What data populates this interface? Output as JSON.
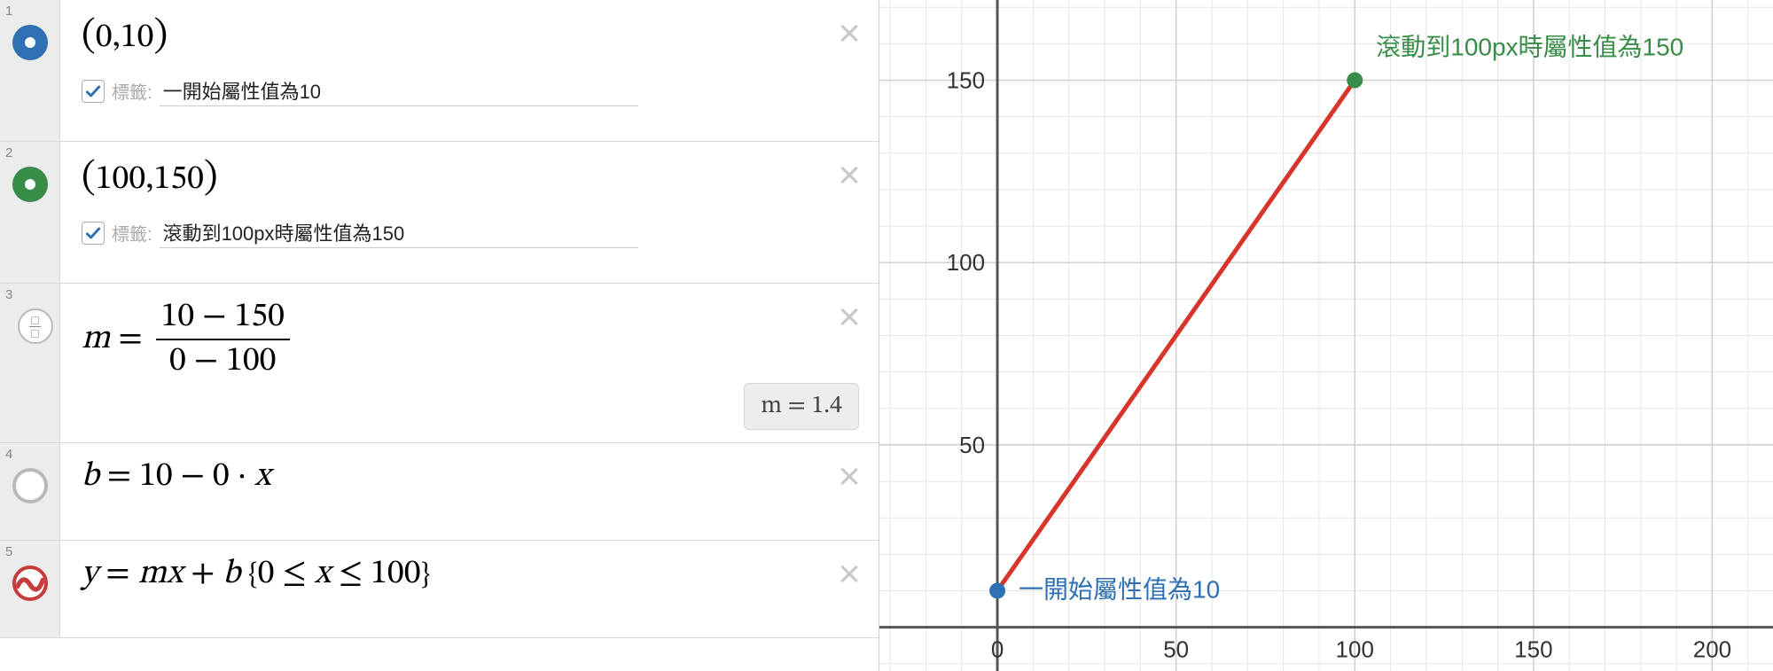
{
  "rows": [
    {
      "index": "1",
      "marker": "blue",
      "math_html": "<span class='paren'>(</span>0,10<span class='paren'>)</span>",
      "label_checked": true,
      "label_hint": "標籤:",
      "label_value": "一開始屬性值為10"
    },
    {
      "index": "2",
      "marker": "green",
      "math_html": "<span class='paren'>(</span>100,150<span class='paren'>)</span>",
      "label_checked": true,
      "label_hint": "標籤:",
      "label_value": "滾動到100px時屬性值為150"
    },
    {
      "index": "3",
      "marker": "frac",
      "math_html": "<span class='it'>m</span> = <span class='frac'><span class='num'>10 − 150</span><span class='den'>0 − 100</span></span>",
      "result": "m  =  1.4"
    },
    {
      "index": "4",
      "marker": "gray",
      "math_html": "<span class='it'>b</span> = 10 − 0 · <span class='it'>x</span>"
    },
    {
      "index": "5",
      "marker": "red",
      "math_html": "<span class='it'>y</span> = <span class='it'>m</span><span class='it'>x</span> + <span class='it'>b</span> <span class='small'>{</span>0 ≤ <span class='it'>x</span> ≤ 100<span class='small'>}</span>"
    }
  ],
  "graph": {
    "x_ticks": [
      0,
      50,
      100,
      150,
      200
    ],
    "y_ticks": [
      50,
      100,
      150
    ],
    "points": [
      {
        "x": 0,
        "y": 10,
        "color": "#2e70b3",
        "label": "一開始屬性值為10",
        "label_color": "#2e70b3",
        "label_dx": 24,
        "label_dy": 8
      },
      {
        "x": 100,
        "y": 150,
        "color": "#378c47",
        "label": "滾動到100px時屬性值為150",
        "label_color": "#378c47",
        "label_dx": 24,
        "label_dy": -28
      }
    ],
    "line_color": "#d9342b"
  },
  "chart_data": {
    "type": "line",
    "title": "",
    "xlabel": "",
    "ylabel": "",
    "xlim": [
      -10,
      215
    ],
    "ylim": [
      -10,
      170
    ],
    "x": [
      0,
      100
    ],
    "y": [
      10,
      150
    ],
    "series": [
      {
        "name": "y = mx + b (m=1.4, b=10)",
        "x": [
          0,
          100
        ],
        "y": [
          10,
          150
        ],
        "color": "#d9342b"
      }
    ],
    "annotations": [
      {
        "x": 0,
        "y": 10,
        "text": "一開始屬性值為10",
        "color": "#2e70b3"
      },
      {
        "x": 100,
        "y": 150,
        "text": "滾動到100px時屬性值為150",
        "color": "#378c47"
      }
    ],
    "x_ticks": [
      0,
      50,
      100,
      150,
      200
    ],
    "y_ticks": [
      50,
      100,
      150
    ]
  }
}
